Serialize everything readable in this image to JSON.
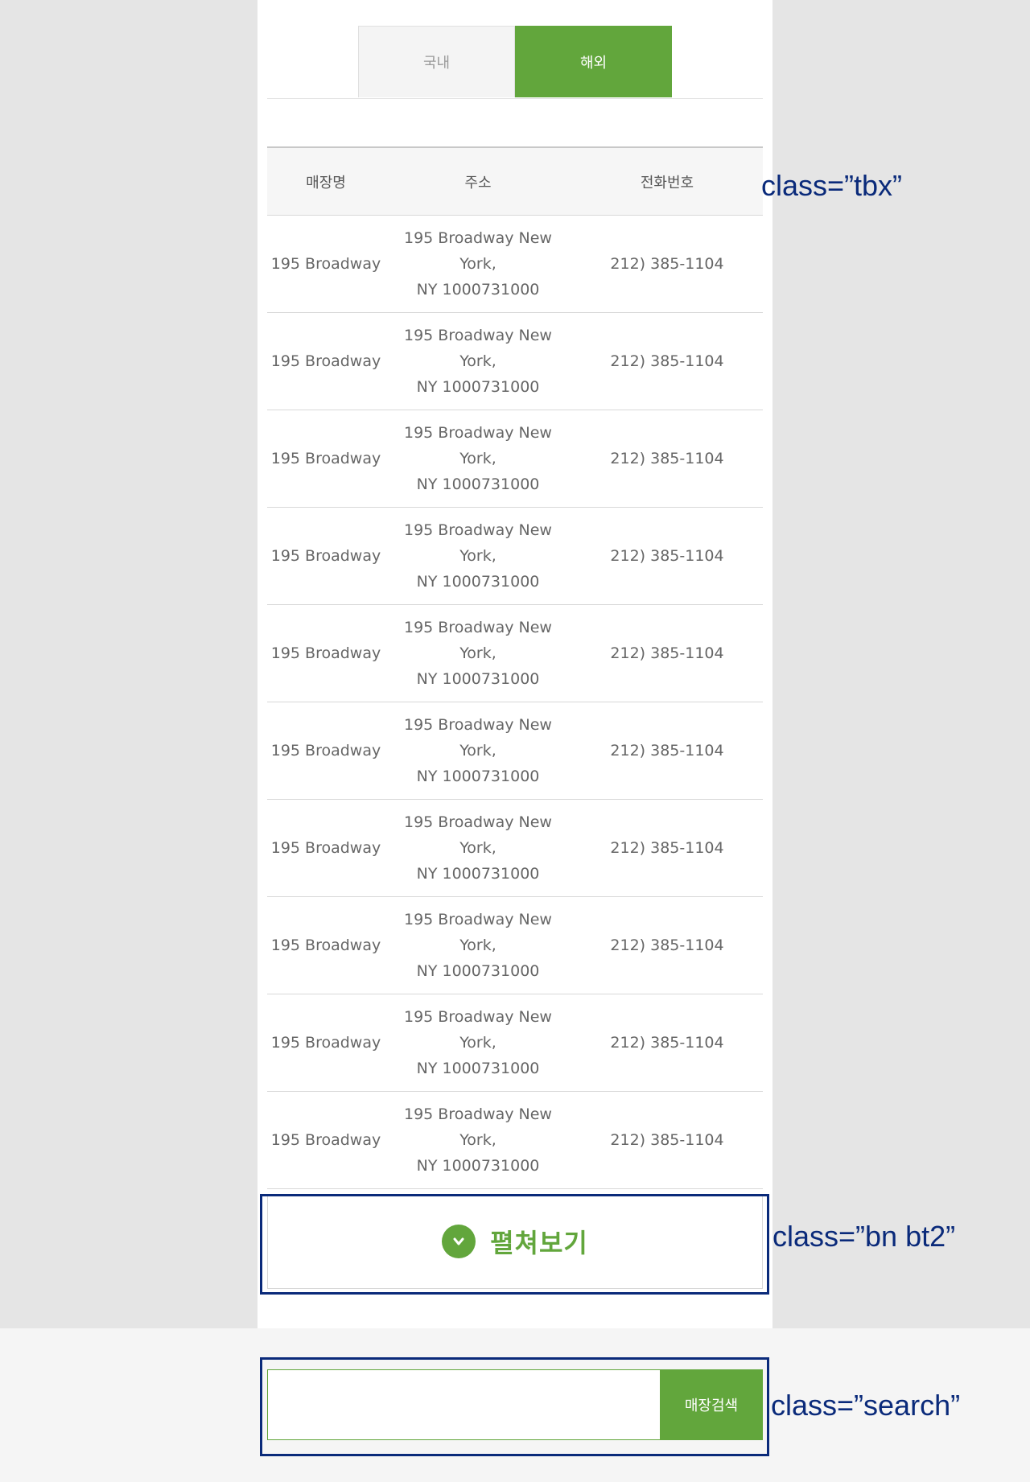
{
  "tabs": [
    {
      "label": "국내",
      "active": false
    },
    {
      "label": "해외",
      "active": true
    }
  ],
  "table": {
    "headers": [
      "매장명",
      "주소",
      "전화번호"
    ],
    "rows": [
      {
        "name": "195 Broadway",
        "addr1": "195 Broadway New York,",
        "addr2": "NY 1000731000",
        "phone": "212) 385-1104"
      },
      {
        "name": "195 Broadway",
        "addr1": "195 Broadway New York,",
        "addr2": "NY 1000731000",
        "phone": "212) 385-1104"
      },
      {
        "name": "195 Broadway",
        "addr1": "195 Broadway New York,",
        "addr2": "NY 1000731000",
        "phone": "212) 385-1104"
      },
      {
        "name": "195 Broadway",
        "addr1": "195 Broadway New York,",
        "addr2": "NY 1000731000",
        "phone": "212) 385-1104"
      },
      {
        "name": "195 Broadway",
        "addr1": "195 Broadway New York,",
        "addr2": "NY 1000731000",
        "phone": "212) 385-1104"
      },
      {
        "name": "195 Broadway",
        "addr1": "195 Broadway New York,",
        "addr2": "NY 1000731000",
        "phone": "212) 385-1104"
      },
      {
        "name": "195 Broadway",
        "addr1": "195 Broadway New York,",
        "addr2": "NY 1000731000",
        "phone": "212) 385-1104"
      },
      {
        "name": "195 Broadway",
        "addr1": "195 Broadway New York,",
        "addr2": "NY 1000731000",
        "phone": "212) 385-1104"
      },
      {
        "name": "195 Broadway",
        "addr1": "195 Broadway New York,",
        "addr2": "NY 1000731000",
        "phone": "212) 385-1104"
      },
      {
        "name": "195 Broadway",
        "addr1": "195 Broadway New York,",
        "addr2": "NY 1000731000",
        "phone": "212) 385-1104"
      }
    ]
  },
  "expand_button": {
    "label": "펼쳐보기",
    "icon": "chevron-down-icon"
  },
  "search": {
    "placeholder": "",
    "value": "",
    "button_label": "매장검색"
  },
  "annotations": {
    "tbx": "class=”tbx”",
    "bn": "class=”bn bt2”",
    "search": "class=”search”"
  },
  "colors": {
    "accent": "#62a63c",
    "annotation": "#0a2a7a",
    "background": "#e5e5e5"
  }
}
